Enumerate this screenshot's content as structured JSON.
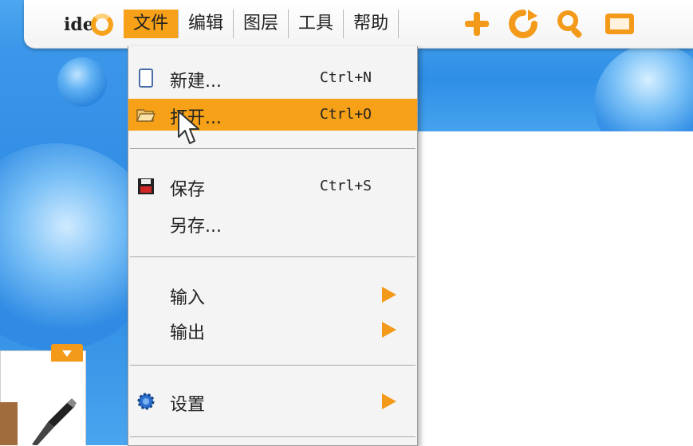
{
  "app": {
    "logo_text": "ide"
  },
  "menubar": {
    "items": [
      {
        "label": "文件",
        "active": true
      },
      {
        "label": "编辑"
      },
      {
        "label": "图层"
      },
      {
        "label": "工具"
      },
      {
        "label": "帮助"
      }
    ],
    "tools": [
      "add-icon",
      "rotate-icon",
      "zoom-icon",
      "frame-icon"
    ]
  },
  "file_menu": {
    "items": [
      {
        "label": "新建...",
        "shortcut": "Ctrl+N",
        "icon": "new-document-icon"
      },
      {
        "label": "打开...",
        "shortcut": "Ctrl+O",
        "icon": "open-folder-icon",
        "highlighted": true
      },
      {
        "label": "保存",
        "shortcut": "Ctrl+S",
        "icon": "save-icon"
      },
      {
        "label": "另存..."
      },
      {
        "label": "输入",
        "submenu": true
      },
      {
        "label": "输出",
        "submenu": true
      },
      {
        "label": "设置",
        "submenu": true,
        "icon": "settings-gear-icon"
      }
    ]
  },
  "colors": {
    "accent": "#f6a117",
    "background_blue": "#2f8fe6"
  }
}
